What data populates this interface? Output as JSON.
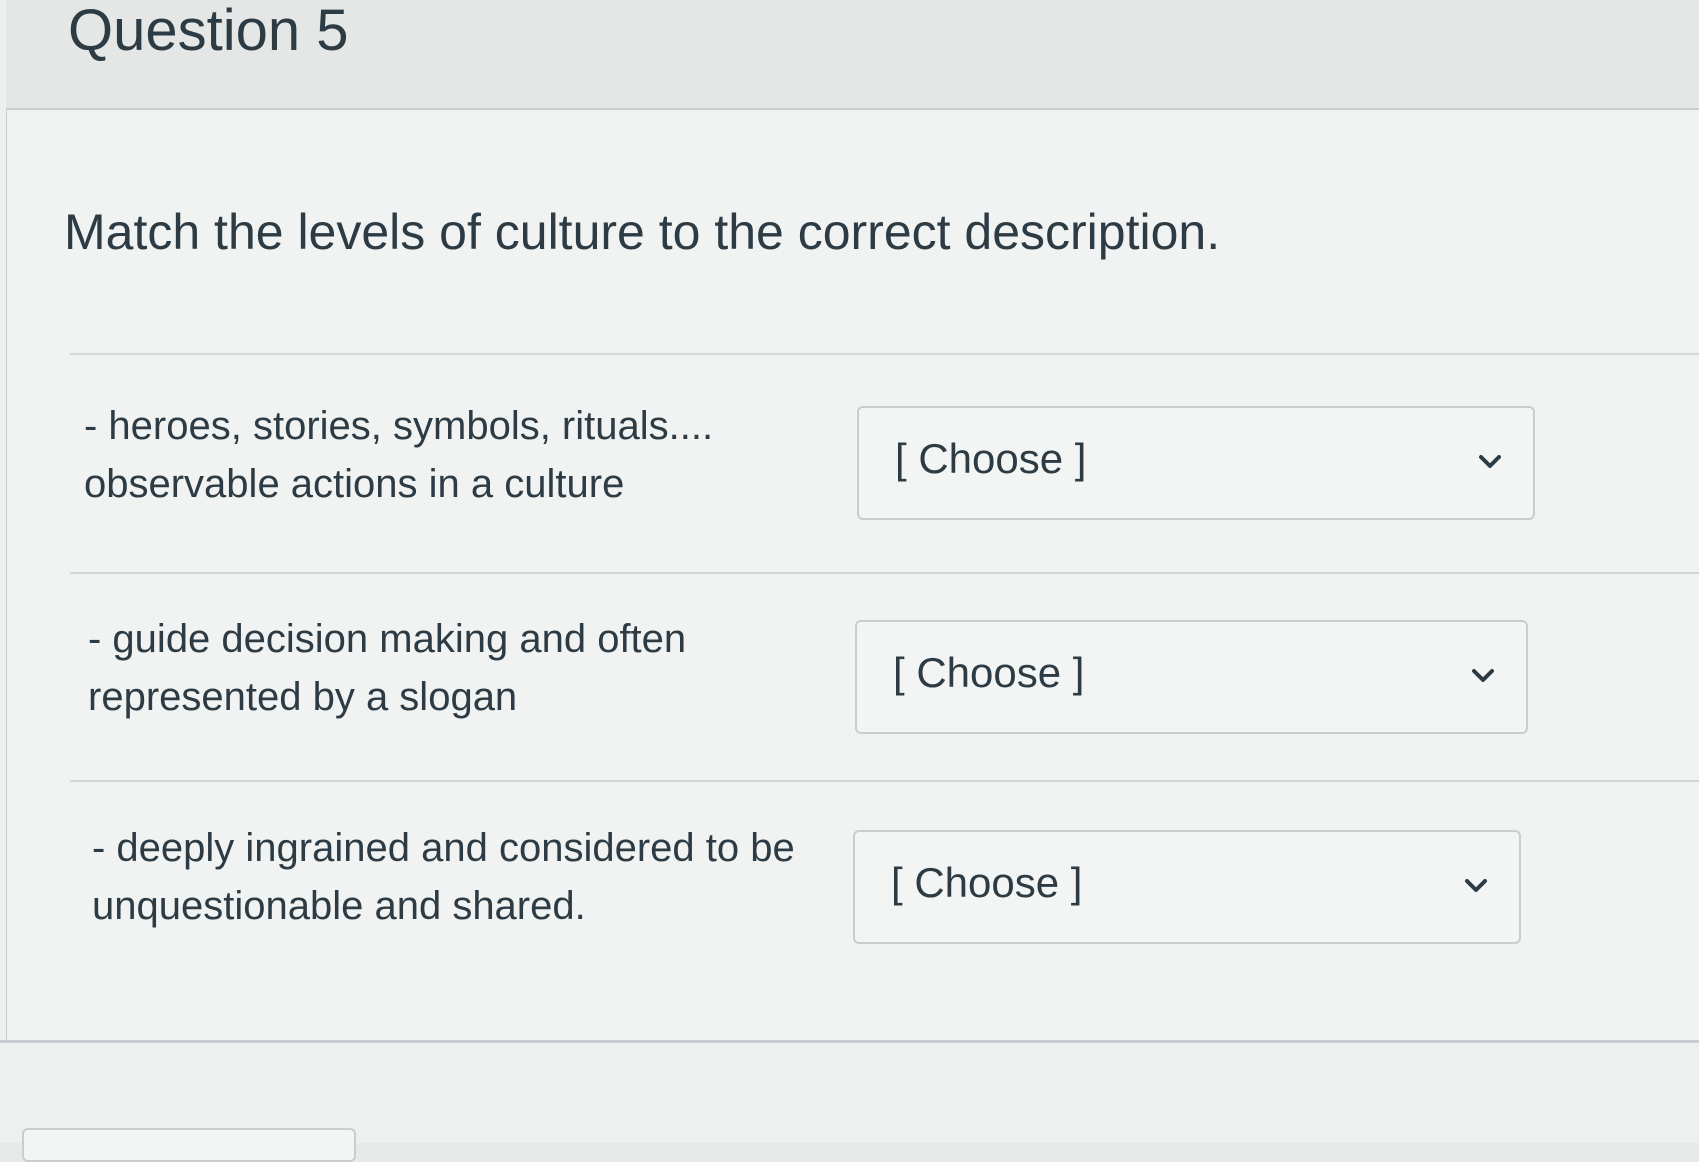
{
  "question": {
    "title": "Question 5",
    "prompt": "Match the levels of culture to the correct description.",
    "rows": [
      {
        "line1": "- heroes, stories, symbols, rituals....",
        "line2": "observable actions in a culture",
        "select_value": "[ Choose ]",
        "chevron_icon": "chevron-down-icon"
      },
      {
        "line1": "- guide decision making and often",
        "line2": "represented by a slogan",
        "select_value": "[ Choose ]",
        "chevron_icon": "chevron-down-icon"
      },
      {
        "line1": "- deeply ingrained and considered to be",
        "line2": "unquestionable and shared.",
        "select_value": "[ Choose ]",
        "chevron_icon": "chevron-down-icon"
      }
    ]
  },
  "colors": {
    "text": "#2d3b45",
    "border": "#c7cdd1",
    "background": "#eef0ef"
  }
}
